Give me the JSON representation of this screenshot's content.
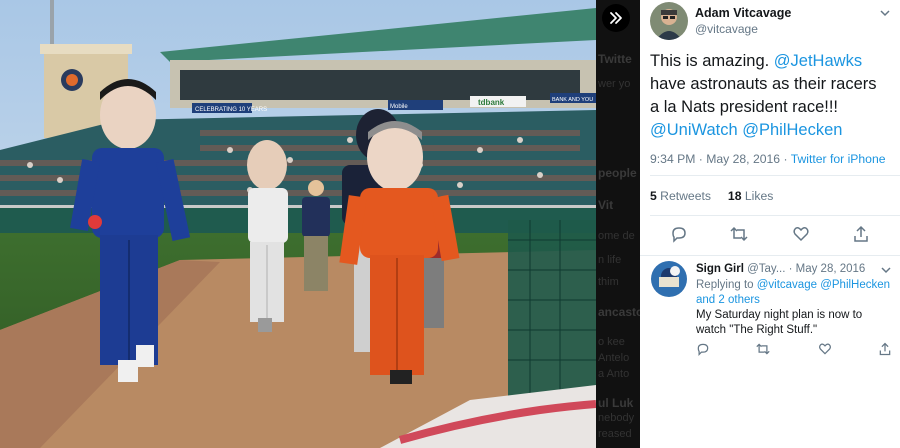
{
  "photo": {
    "scoreboard_text_1": "CELEBRATING 10 YEARS",
    "scoreboard_text_2": "tdbank",
    "scoreboard_text_3": "Mobile",
    "scoreboard_text_4": "BANK AND YOU"
  },
  "background_panel": {
    "fragments": [
      "Twitte",
      "wer yo",
      "people",
      "Vit",
      "ome de",
      "n life",
      "thim",
      "ancasto",
      "o kee",
      "Antelo",
      "a Anto",
      "ul Luk",
      "nebody",
      "reased"
    ]
  },
  "tweet": {
    "author_name": "Adam Vitcavage",
    "author_handle": "@vitcavage",
    "text_intro": "This is amazing. ",
    "mention_1": "@JetHawks",
    "text_mid": " have astronauts as their racers a la Nats president race!!! ",
    "mention_2": "@UniWatch",
    "text_space": " ",
    "mention_3": "@PhilHecken",
    "timestamp": "9:34 PM · May 28, 2016 · ",
    "source": "Twitter for iPhone",
    "retweets_count": "5",
    "retweets_label": " Retweets",
    "likes_count": "18",
    "likes_label": " Likes"
  },
  "reply": {
    "author_name": "Sign Girl",
    "author_handle": " @Tay...",
    "date": " · May 28, 2016",
    "replying_prefix": "Replying to ",
    "replying_1": "@vitcavage",
    "replying_2": "@PhilHecken",
    "replying_3": "and 2 others",
    "text": "My Saturday night plan is now to watch \"The Right Stuff.\""
  },
  "icons": [
    "expand-icon",
    "chevron-down-icon",
    "reply-icon",
    "retweet-icon",
    "like-icon",
    "share-icon"
  ]
}
